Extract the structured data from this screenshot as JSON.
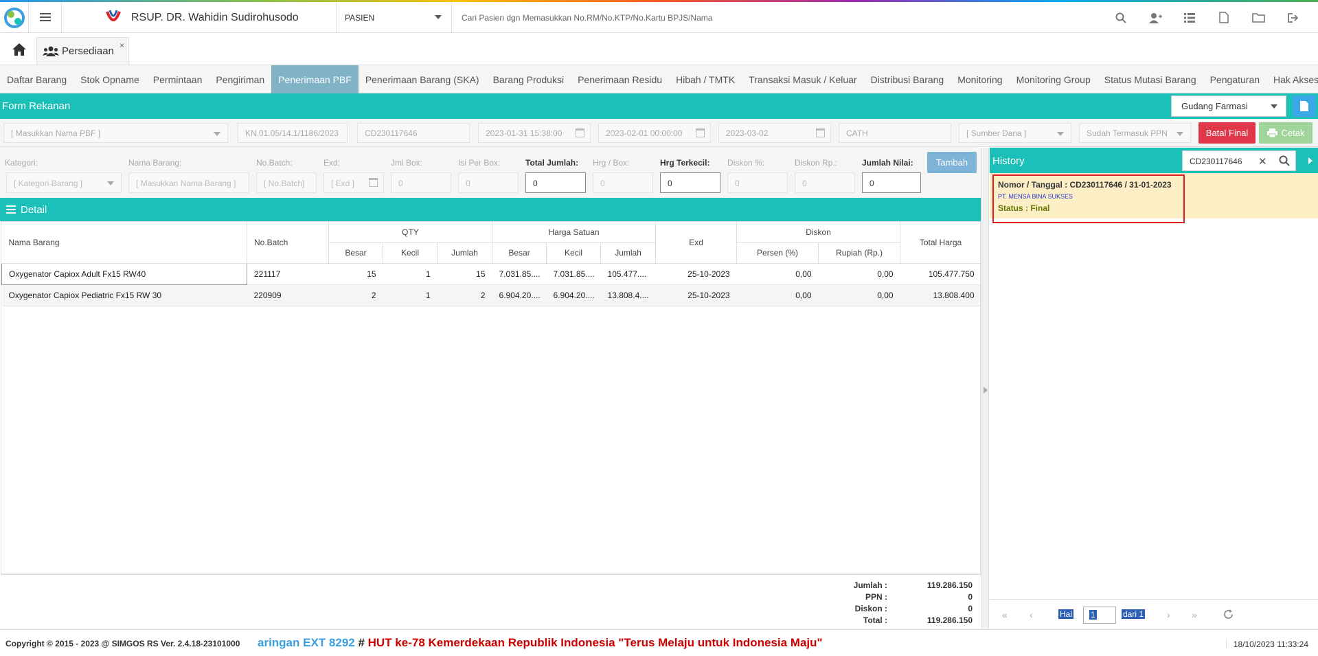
{
  "header": {
    "hospital_name": "RSUP. DR. Wahidin Sudirohusodo",
    "patient_select": "PASIEN",
    "patient_search_placeholder": "Cari Pasien dgn Memasukkan No.RM/No.KTP/No.Kartu BPJS/Nama",
    "icons": [
      "search-icon",
      "user-plus-icon",
      "list-icon",
      "pdf-icon",
      "folder-icon",
      "logout-icon"
    ]
  },
  "module_tab": {
    "label": "Persediaan",
    "close": "×"
  },
  "nav_tabs": [
    {
      "label": "Daftar Barang",
      "active": false
    },
    {
      "label": "Stok Opname",
      "active": false
    },
    {
      "label": "Permintaan",
      "active": false
    },
    {
      "label": "Pengiriman",
      "active": false
    },
    {
      "label": "Penerimaan PBF",
      "active": true
    },
    {
      "label": "Penerimaan Barang (SKA)",
      "active": false
    },
    {
      "label": "Barang Produksi",
      "active": false
    },
    {
      "label": "Penerimaan Residu",
      "active": false
    },
    {
      "label": "Hibah / TMTK",
      "active": false
    },
    {
      "label": "Transaksi Masuk / Keluar",
      "active": false
    },
    {
      "label": "Distribusi Barang",
      "active": false
    },
    {
      "label": "Monitoring",
      "active": false
    },
    {
      "label": "Monitoring Group",
      "active": false
    },
    {
      "label": "Status Mutasi Barang",
      "active": false
    },
    {
      "label": "Pengaturan",
      "active": false
    },
    {
      "label": "Hak Akses",
      "active": false
    }
  ],
  "form": {
    "title": "Form Rekanan",
    "gudang": "Gudang Farmasi",
    "pbf_placeholder": "[ Masukkan Nama PBF ]",
    "no_faktur": "KN.01.05/14.1/1186/2023",
    "no_dokumen": "CD230117646",
    "tanggal_1": "2023-01-31 15:38:00",
    "tanggal_2": "2023-02-01 00:00:00",
    "tanggal_3": "2023-03-02",
    "keterangan": "CATH",
    "sumber_dana_placeholder": "[ Sumber Dana ]",
    "ppn_select": "Sudah Termasuk PPN",
    "btn_batal": "Batal Final",
    "btn_cetak": "Cetak"
  },
  "item_form": {
    "labels": {
      "kategori": "Kategori:",
      "nama_barang": "Nama Barang:",
      "no_batch": "No.Batch:",
      "exd": "Exd:",
      "jml_box": "Jml Box:",
      "isi_per_box": "Isi Per Box:",
      "total_jumlah": "Total Jumlah:",
      "hrg_box": "Hrg / Box:",
      "hrg_terkecil": "Hrg Terkecil:",
      "diskon_pct": "Diskon %:",
      "diskon_rp": "Diskon Rp.:",
      "jumlah_nilai": "Jumlah Nilai:"
    },
    "placeholders": {
      "kategori": "[ Kategori Barang ]",
      "nama_barang": "[ Masukkan Nama Barang ]",
      "no_batch": "[ No.Batch]",
      "exd": "[ Exd ]"
    },
    "values": {
      "jml_box": "0",
      "isi_per_box": "0",
      "total_jumlah": "0",
      "hrg_box": "0",
      "hrg_terkecil": "0",
      "diskon_pct": "0",
      "diskon_rp": "0",
      "jumlah_nilai": "0"
    },
    "btn_tambah": "Tambah"
  },
  "detail": {
    "title": "Detail",
    "headers": {
      "nama_barang": "Nama Barang",
      "no_batch": "No.Batch",
      "qty": "QTY",
      "harga_satuan": "Harga Satuan",
      "exd": "Exd",
      "diskon": "Diskon",
      "total_harga": "Total Harga",
      "besar": "Besar",
      "kecil": "Kecil",
      "jumlah": "Jumlah",
      "persen": "Persen (%)",
      "rupiah": "Rupiah (Rp.)"
    },
    "rows": [
      {
        "nama": "Oxygenator Capiox Adult Fx15 RW40",
        "batch": "221117",
        "qty_besar": "15",
        "qty_kecil": "1",
        "qty_jumlah": "15",
        "hs_besar": "7.031.85....",
        "hs_kecil": "7.031.85....",
        "hs_jumlah": "105.477....",
        "exd": "25-10-2023",
        "persen": "0,00",
        "rupiah": "0,00",
        "total": "105.477.750"
      },
      {
        "nama": "Oxygenator Capiox Pediatric Fx15 RW 30",
        "batch": "220909",
        "qty_besar": "2",
        "qty_kecil": "1",
        "qty_jumlah": "2",
        "hs_besar": "6.904.20....",
        "hs_kecil": "6.904.20....",
        "hs_jumlah": "13.808.4....",
        "exd": "25-10-2023",
        "persen": "0,00",
        "rupiah": "0,00",
        "total": "13.808.400"
      }
    ],
    "summary": {
      "jumlah_label": "Jumlah :",
      "jumlah": "119.286.150",
      "ppn_label": "PPN :",
      "ppn": "0",
      "diskon_label": "Diskon :",
      "diskon": "0",
      "total_label": "Total :",
      "total": "119.286.150"
    }
  },
  "history": {
    "title": "History",
    "search_value": "CD230117646",
    "item": {
      "nomor": "Nomor / Tanggal : CD230117646 / 31-01-2023",
      "vendor": "PT. MENSA BINA SUKSES",
      "status": "Status : Final"
    },
    "pager": {
      "hal": "Hal",
      "page": "1",
      "dari": "dari 1"
    }
  },
  "footer": {
    "copyright": "Copyright © 2015 - 2023 @ SIMGOS RS Ver. 2.4.18-23101000",
    "marquee_blue": "aringan EXT 8292",
    "marquee_hash": " # ",
    "marquee_red": "HUT ke-78 Kemerdekaan Republik Indonesia \"Terus Melaju untuk Indonesia Maju\"",
    "datetime": "18/10/2023 11:33:24"
  }
}
